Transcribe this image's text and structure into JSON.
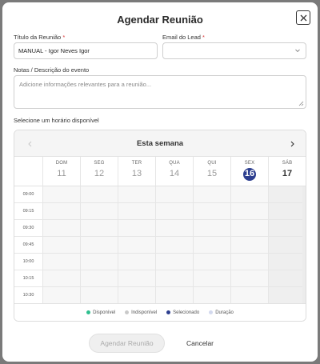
{
  "modal": {
    "title": "Agendar Reunião"
  },
  "form": {
    "title_label": "Título da Reunião",
    "title_required": "*",
    "title_value": "MANUAL - Igor Neves Igor",
    "email_label": "Email do Lead",
    "email_required": "*",
    "email_value": "",
    "notes_label": "Notas / Descrição do evento",
    "notes_placeholder": "Adicione informações relevantes para a reunião...",
    "slot_label": "Selecione um horário disponível"
  },
  "calendar": {
    "header": "Esta semana",
    "days": [
      {
        "name": "DOM",
        "num": "11"
      },
      {
        "name": "SEG",
        "num": "12"
      },
      {
        "name": "TER",
        "num": "13"
      },
      {
        "name": "QUA",
        "num": "14"
      },
      {
        "name": "QUI",
        "num": "15"
      },
      {
        "name": "SEX",
        "num": "16",
        "selected": true
      },
      {
        "name": "SÁB",
        "num": "17"
      }
    ],
    "times": [
      "09:00",
      "09:15",
      "09:30",
      "09:45",
      "10:00",
      "10:15",
      "10:30"
    ],
    "legend": [
      {
        "label": "Disponível",
        "color": "#2fbf8f"
      },
      {
        "label": "Indisponível",
        "color": "#c9c9c9"
      },
      {
        "label": "Selecionado",
        "color": "#2c3e8f"
      },
      {
        "label": "Duração",
        "color": "#d3d9ee"
      }
    ]
  },
  "actions": {
    "submit": "Agendar Reunião",
    "cancel": "Cancelar"
  },
  "colors": {
    "accent": "#2c3e8f",
    "required": "#d93636"
  }
}
